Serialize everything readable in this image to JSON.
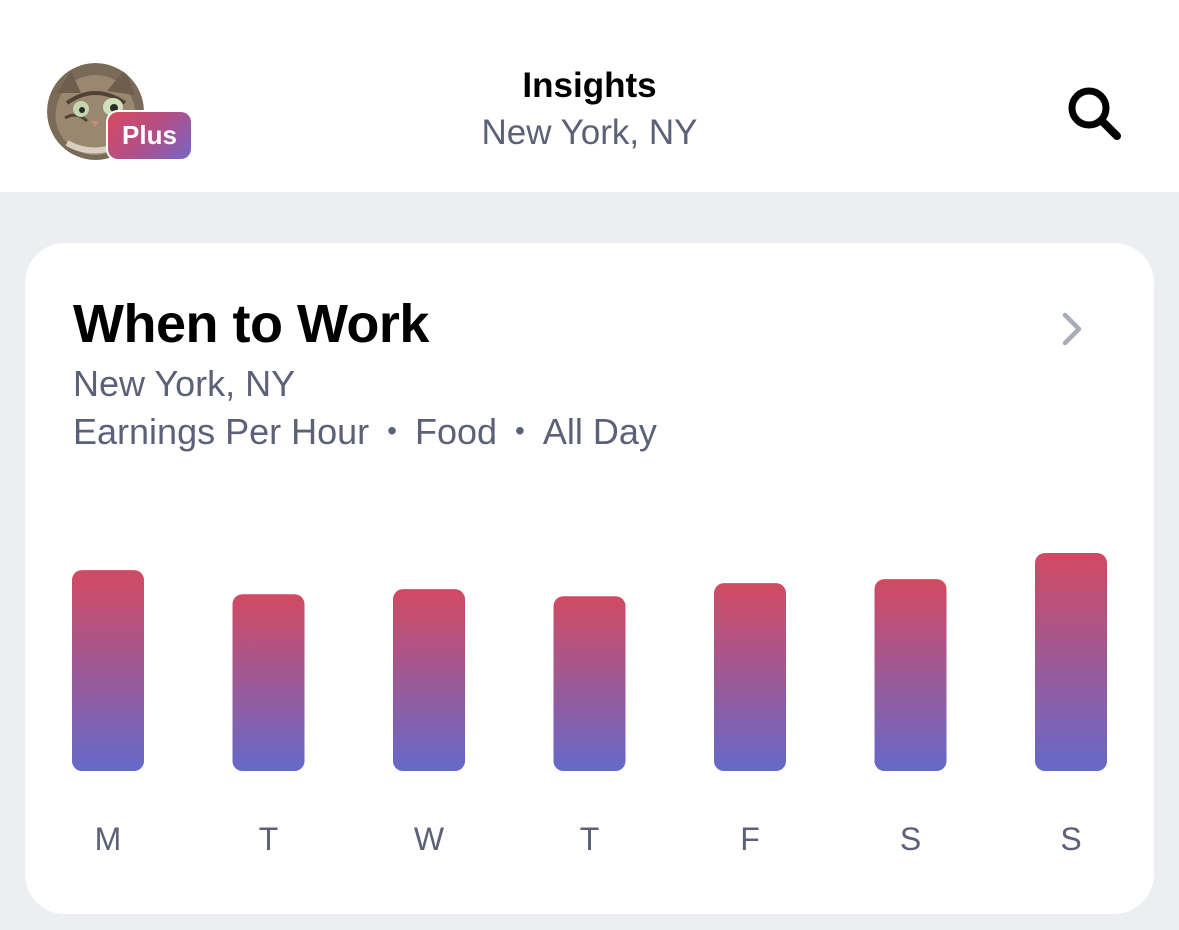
{
  "header": {
    "title": "Insights",
    "subtitle": "New York, NY",
    "badge": "Plus",
    "avatar": "cat-avatar",
    "search_icon": "search-icon"
  },
  "card": {
    "title": "When to Work",
    "location": "New York, NY",
    "filters": [
      "Earnings Per Hour",
      "Food",
      "All Day"
    ],
    "chevron_icon": "chevron-right-icon"
  },
  "colors": {
    "bar_top": "#D24A62",
    "bar_bottom": "#6669C9",
    "text_secondary": "#5C6178",
    "background": "#ECEEF2"
  },
  "chart_data": {
    "type": "bar",
    "categories": [
      "M",
      "T",
      "W",
      "T",
      "F",
      "S",
      "S"
    ],
    "values": [
      200,
      176,
      181,
      174,
      187,
      191,
      217
    ],
    "ylim": [
      0,
      217
    ],
    "grid": false
  }
}
